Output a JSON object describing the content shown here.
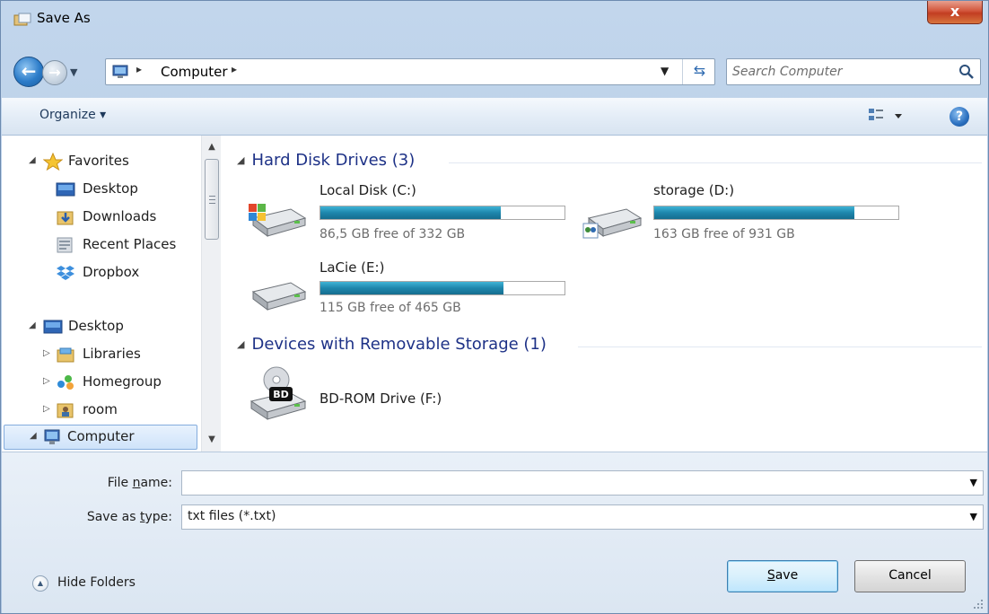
{
  "window": {
    "title": "Save As",
    "close_label": "x"
  },
  "address": {
    "location": "Computer",
    "separator": "▸",
    "search_placeholder": "Search Computer"
  },
  "toolbar": {
    "organize_label": "Organize ▾",
    "help_label": "?"
  },
  "nav": {
    "items": [
      {
        "label": "Favorites",
        "icon": "star-icon"
      },
      {
        "label": "Desktop",
        "icon": "desktop-icon"
      },
      {
        "label": "Downloads",
        "icon": "downloads-folder-icon"
      },
      {
        "label": "Recent Places",
        "icon": "recent-places-icon"
      },
      {
        "label": "Dropbox",
        "icon": "dropbox-icon"
      },
      {
        "label": "Desktop",
        "icon": "desktop-icon"
      },
      {
        "label": "Libraries",
        "icon": "libraries-icon"
      },
      {
        "label": "Homegroup",
        "icon": "homegroup-icon"
      },
      {
        "label": "room",
        "icon": "user-folder-icon"
      },
      {
        "label": "Computer",
        "icon": "computer-icon"
      }
    ]
  },
  "content": {
    "groups": [
      {
        "label": "Hard Disk Drives (3)"
      },
      {
        "label": "Devices with Removable Storage (1)"
      }
    ],
    "drives": [
      {
        "name": "Local Disk (C:)",
        "free": "86,5 GB free of 332 GB",
        "used_fraction": 0.74,
        "icon": "system-drive-icon"
      },
      {
        "name": "storage (D:)",
        "free": "163 GB free of 931 GB",
        "used_fraction": 0.82,
        "icon": "hard-drive-icon"
      },
      {
        "name": "LaCie (E:)",
        "free": "115 GB free of 465 GB",
        "used_fraction": 0.75,
        "icon": "hard-drive-icon"
      },
      {
        "name": "BD-ROM Drive (F:)",
        "icon": "bd-rom-drive-icon"
      }
    ]
  },
  "form": {
    "file_name_label_pre": "File ",
    "file_name_label_u": "n",
    "file_name_label_post": "ame:",
    "file_name_value": "",
    "type_label_pre": "Save as ",
    "type_label_u": "t",
    "type_label_post": "ype:",
    "type_value": "txt files (*.txt)",
    "hide_folders_label": "Hide Folders",
    "save_label_u": "S",
    "save_label_post": "ave",
    "cancel_label": "Cancel"
  },
  "colors": {
    "accent": "#1e86ac",
    "group_header": "#1e3287"
  }
}
